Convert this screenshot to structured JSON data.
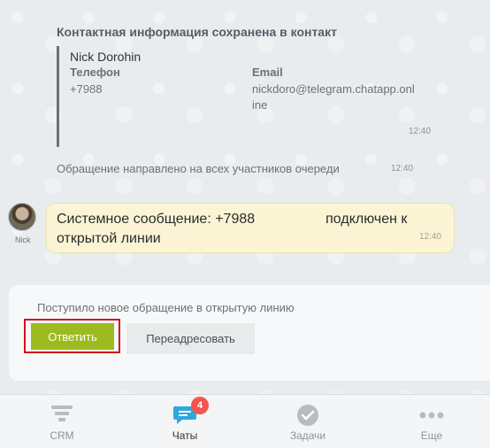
{
  "contact": {
    "title": "Контактная информация сохранена в контакт",
    "name": "Nick Dorohin",
    "phone_label": "Телефон",
    "phone_value": "+7988",
    "email_label": "Email",
    "email_value_line1": "nickdoro@telegram.chatapp.onl",
    "email_value_line2": "ine",
    "time": "12:40"
  },
  "system_note": {
    "text": "Обращение направлено на всех участников очереди",
    "time": "12:40"
  },
  "message": {
    "avatar_name": "Nick",
    "text_part1": "Системное сообщение: +7988",
    "text_part2": "подключен к открытой линии",
    "time": "12:40"
  },
  "action_panel": {
    "caption": "Поступило новое обращение в открытую линию",
    "answer_label": "Ответить",
    "forward_label": "Переадресовать"
  },
  "tabs": [
    {
      "label": "CRM",
      "icon": "crm-icon"
    },
    {
      "label": "Чаты",
      "icon": "chat-icon",
      "badge": "4",
      "active": true
    },
    {
      "label": "Задачи",
      "icon": "check-icon"
    },
    {
      "label": "Еще",
      "icon": "more-icon"
    }
  ],
  "colors": {
    "accent_green": "#9dba1f",
    "badge_red": "#f2564d",
    "chat_blue": "#2fa7e0",
    "highlight_red": "#d4101a"
  }
}
